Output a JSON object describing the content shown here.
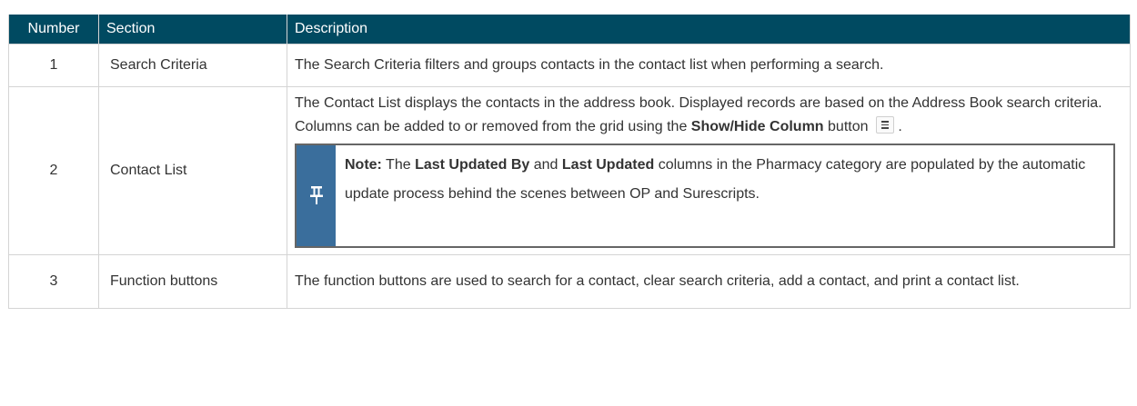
{
  "table": {
    "headers": {
      "number": "Number",
      "section": "Section",
      "description": "Description"
    },
    "rows": [
      {
        "number": "1",
        "section": "Search Criteria",
        "description": "The Search Criteria filters and groups contacts in the contact list when performing a search."
      },
      {
        "number": "2",
        "section": "Contact List",
        "description_pre": "The Contact List displays the contacts in the address book. Displayed records are based on the Address Book search criteria. Columns can be added to or removed from the grid using the ",
        "description_bold": "Show/Hide Column",
        "description_post": " button",
        "description_end": ".",
        "icon": "column-list-icon",
        "note": {
          "label": "Note:",
          "text1": " The ",
          "bold1": "Last Updated By",
          "text2": " and ",
          "bold2": "Last Updated",
          "text3": " columns in the Pharmacy category are populated by the automatic update process behind the scenes between OP and Surescripts.",
          "icon": "pushpin-icon"
        }
      },
      {
        "number": "3",
        "section": "Function buttons",
        "description": "The function buttons are used to search for a contact, clear search criteria, add a contact, and print a contact list."
      }
    ]
  },
  "colors": {
    "header_bg": "#004a61",
    "note_bar": "#3a6e9c",
    "note_border": "#666666",
    "grid": "#d4d4d4"
  }
}
